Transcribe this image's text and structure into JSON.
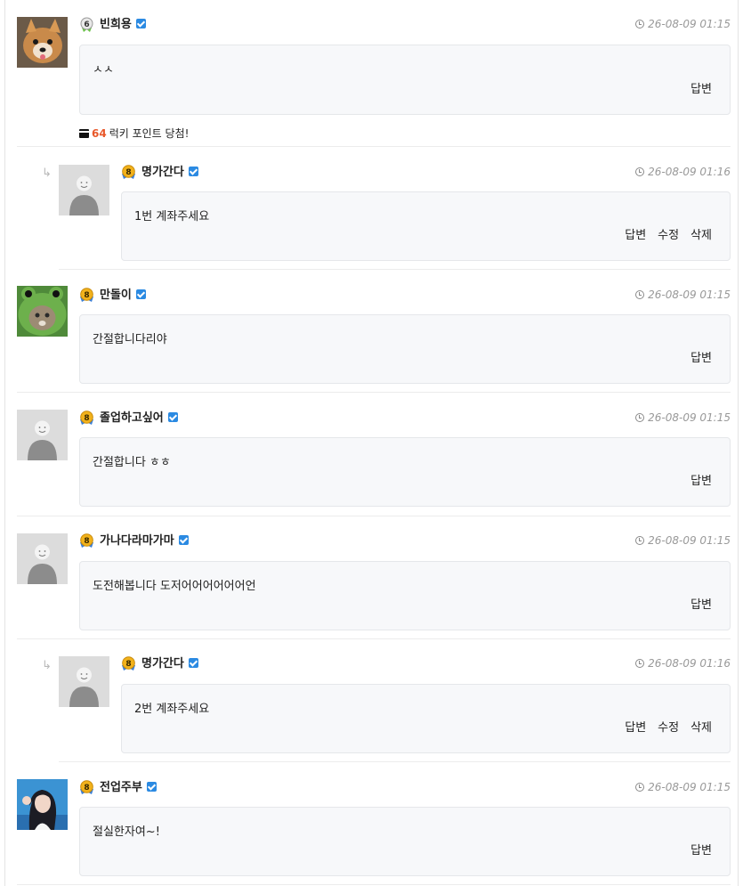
{
  "comments": [
    {
      "name": "빈희용",
      "level": "6",
      "time": "26-08-09 01:15",
      "text": "ㅅㅅ",
      "actions": [
        "답변"
      ]
    },
    {
      "name": "명가간다",
      "level": "8",
      "time": "26-08-09 01:16",
      "text": "1번 계좌주세요",
      "actions": [
        "답변",
        "수정",
        "삭제"
      ]
    },
    {
      "name": "만돌이",
      "level": "8",
      "time": "26-08-09 01:15",
      "text": "간절합니다리야",
      "actions": [
        "답변"
      ]
    },
    {
      "name": "졸업하고싶어",
      "level": "8",
      "time": "26-08-09 01:15",
      "text": "간절합니다 ㅎㅎ",
      "actions": [
        "답변"
      ]
    },
    {
      "name": "가나다라마가마",
      "level": "8",
      "time": "26-08-09 01:15",
      "text": "도전해봅니다 도저어어어어어어언",
      "actions": [
        "답변"
      ]
    },
    {
      "name": "명가간다",
      "level": "8",
      "time": "26-08-09 01:16",
      "text": "2번 계좌주세요",
      "actions": [
        "답변",
        "수정",
        "삭제"
      ]
    },
    {
      "name": "전업주부",
      "level": "8",
      "time": "26-08-09 01:15",
      "text": "절실한자여~!",
      "actions": [
        "답변"
      ]
    }
  ],
  "lucky_points": {
    "points": "64",
    "text": "럭키 포인트 당첨!"
  },
  "icons": {
    "reply": "reply-arrow-icon",
    "verified": "verified-check-icon",
    "clock": "clock-icon",
    "gift": "gift-icon"
  },
  "colors": {
    "verified": "#2b8ae2",
    "points": "#e8582a",
    "level_badge": "#f2b21b"
  }
}
